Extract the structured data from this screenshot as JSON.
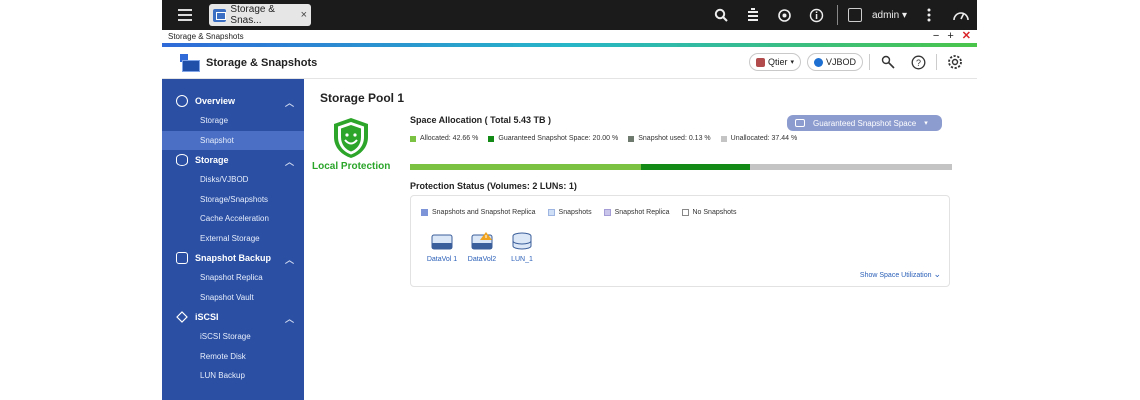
{
  "topbar": {
    "tab_label": "Storage & Snas...",
    "tab_close": "×",
    "user_label": "admin ▾"
  },
  "window": {
    "title": "Storage & Snapshots",
    "minimize": "−",
    "maximize": "+",
    "close": "✕"
  },
  "app": {
    "title": "Storage & Snapshots",
    "qtier_label": "Qtier",
    "vjbod_label": "VJBOD"
  },
  "sidebar": {
    "groups": [
      {
        "label": "Overview",
        "items": [
          "Storage",
          "Snapshot"
        ]
      },
      {
        "label": "Storage",
        "items": [
          "Disks/VJBOD",
          "Storage/Snapshots",
          "Cache Acceleration",
          "External Storage"
        ]
      },
      {
        "label": "Snapshot Backup",
        "items": [
          "Snapshot Replica",
          "Snapshot Vault"
        ]
      },
      {
        "label": "iSCSI",
        "items": [
          "iSCSI Storage",
          "Remote Disk",
          "LUN Backup"
        ]
      }
    ],
    "active_item": "Snapshot"
  },
  "main": {
    "pool_title": "Storage Pool 1",
    "protection_label": "Local Protection",
    "space_allocation": "Space Allocation ( Total 5.43 TB )",
    "guaranteed_button": "Guaranteed Snapshot Space",
    "allocation_legend": [
      {
        "label": "Allocated: 42.66 %",
        "color": "#7cc242"
      },
      {
        "label": "Guaranteed Snapshot Space: 20.00 %",
        "color": "#138a16"
      },
      {
        "label": "Snapshot used: 0.13 %",
        "color": "#6f7a6f"
      },
      {
        "label": "Unallocated: 37.44 %",
        "color": "#c4c4c4"
      }
    ],
    "allocation_bar": [
      {
        "percent": 42.66,
        "color": "#7cc242"
      },
      {
        "percent": 20.0,
        "color": "#138a16"
      },
      {
        "percent": 0.13,
        "color": "#6f7a6f"
      },
      {
        "percent": 37.21,
        "color": "#c4c4c4"
      }
    ],
    "protection_status": "Protection Status (Volumes: 2 LUNs: 1)",
    "status_legend": [
      {
        "label": "Snapshots and Snapshot Replica",
        "color": "#7d95d8"
      },
      {
        "label": "Snapshots",
        "color": "#cfe0f6"
      },
      {
        "label": "Snapshot Replica",
        "color": "#c9c4ea"
      },
      {
        "label": "No Snapshots",
        "color": "#ffffff"
      }
    ],
    "volumes": [
      {
        "label": "DataVol 1",
        "icon": "volume-icon"
      },
      {
        "label": "DataVol2",
        "icon": "volume-warning-icon"
      },
      {
        "label": "LUN_1",
        "icon": "lun-icon"
      }
    ],
    "show_space": "Show Space Utilization"
  }
}
